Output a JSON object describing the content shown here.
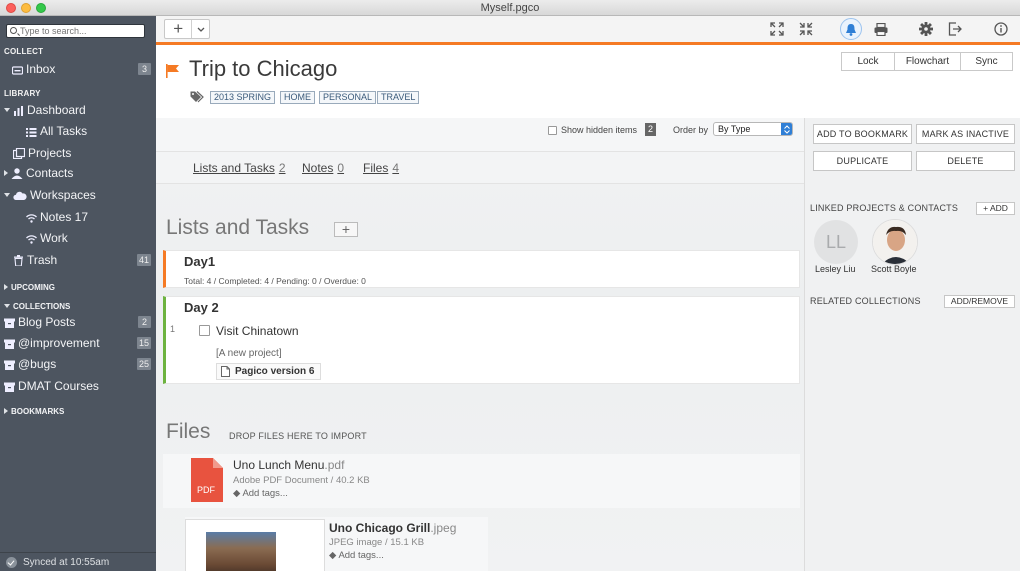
{
  "window": {
    "title": "Myself.pgco"
  },
  "colors": {
    "accent": "#f57a24",
    "sidebar_bg": "#4d5560",
    "day1_bar": "#f57a24",
    "day2_bar": "#6db33f",
    "pdf": "#e8533f",
    "bell": "#2f7fd6"
  },
  "sidebar": {
    "search_placeholder": "Type to search...",
    "collect_heading": "COLLECT",
    "inbox": {
      "label": "Inbox",
      "count": "3"
    },
    "library_heading": "LIBRARY",
    "dashboard": "Dashboard",
    "all_tasks": "All Tasks",
    "projects": "Projects",
    "contacts": "Contacts",
    "workspaces": "Workspaces",
    "notes": "Notes 17",
    "work": "Work",
    "trash": {
      "label": "Trash",
      "count": "41"
    },
    "upcoming_heading": "UPCOMING",
    "collections_heading": "COLLECTIONS",
    "collections": [
      {
        "label": "Blog Posts",
        "count": "2"
      },
      {
        "label": "@improvement",
        "count": "15"
      },
      {
        "label": "@bugs",
        "count": "25"
      },
      {
        "label": "DMAT Courses",
        "count": ""
      }
    ],
    "bookmarks_heading": "BOOKMARKS",
    "status": "Synced at 10:55am"
  },
  "toolbar": {
    "add_symbol": "+",
    "icons": [
      "expand-icon",
      "collapse-icon",
      "bell-icon",
      "print-icon",
      "gear-icon",
      "logout-icon",
      "info-icon"
    ]
  },
  "header": {
    "title": "Trip to Chicago",
    "tags": [
      "2013 SPRING",
      "HOME",
      "PERSONAL",
      "TRAVEL"
    ],
    "segments": [
      "Lock",
      "Flowchart",
      "Sync"
    ]
  },
  "options": {
    "show_hidden_label": "Show hidden items",
    "hidden_count": "2",
    "order_by_label": "Order by",
    "order_by_value": "By Type"
  },
  "tabs": [
    {
      "label": "Lists and Tasks",
      "count": "2"
    },
    {
      "label": "Notes",
      "count": "0"
    },
    {
      "label": "Files",
      "count": "4"
    }
  ],
  "lists": {
    "heading": "Lists and Tasks",
    "add_symbol": "+",
    "day1": {
      "title": "Day1",
      "summary": "Total: 4 / Completed: 4 / Pending: 0 / Overdue: 0"
    },
    "day2": {
      "title": "Day 2",
      "task": {
        "number": "1",
        "title": "Visit Chinatown",
        "project_note": "[A new project]",
        "attachment": "Pagico version 6"
      }
    }
  },
  "files": {
    "heading": "Files",
    "drop_hint": "DROP FILES HERE TO IMPORT",
    "items": [
      {
        "name": "Uno Lunch Menu",
        "ext": ".pdf",
        "meta": "Adobe PDF Document / 40.2 KB",
        "tags": "Add tags...",
        "icon_label": "PDF"
      },
      {
        "name": "Uno Chicago Grill",
        "ext": ".jpeg",
        "meta": "JPEG image / 15.1 KB",
        "tags": "Add tags..."
      }
    ]
  },
  "right": {
    "buttons": [
      "ADD TO BOOKMARK",
      "MARK AS INACTIVE",
      "DUPLICATE",
      "DELETE"
    ],
    "linked_heading": "LINKED PROJECTS & CONTACTS",
    "add_label": "+ ADD",
    "contacts": [
      {
        "initials": "LL",
        "name": "Lesley Liu"
      },
      {
        "name": "Scott Boyle"
      }
    ],
    "related_heading": "RELATED COLLECTIONS",
    "add_remove_label": "ADD/REMOVE"
  }
}
